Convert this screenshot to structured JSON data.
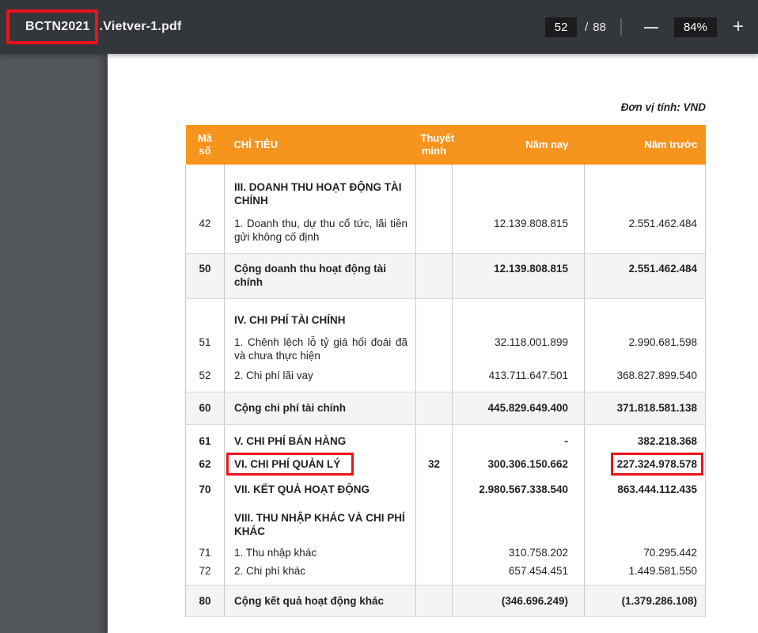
{
  "toolbar": {
    "filename_highlight": "BCTN2021",
    "filename_rest": ".Vietver-1.pdf",
    "page_current": "52",
    "page_separator": "/",
    "page_total": "88",
    "zoom_out_label": "—",
    "zoom_level": "84%",
    "zoom_in_label": "+"
  },
  "page": {
    "unit_note": "Đơn vị tính: VND",
    "table": {
      "headers": {
        "ma_so": "Mã số",
        "chi_tieu": "CHỈ TIÊU",
        "thuyet_minh": "Thuyết minh",
        "nam_nay": "Năm nay",
        "nam_truoc": "Năm trước"
      },
      "rows": [
        {
          "ma_so": "",
          "chi_tieu": "III. DOANH THU HOẠT ĐỘNG TÀI CHÍNH",
          "thuyet_minh": "",
          "nam_nay": "",
          "nam_truoc": ""
        },
        {
          "ma_so": "42",
          "chi_tieu": "1. Doanh thu, dự thu cổ tức, lãi tiền gửi không cố định",
          "thuyet_minh": "",
          "nam_nay": "12.139.808.815",
          "nam_truoc": "2.551.462.484"
        },
        {
          "ma_so": "50",
          "chi_tieu": "Cộng doanh thu hoạt động tài chính",
          "thuyet_minh": "",
          "nam_nay": "12.139.808.815",
          "nam_truoc": "2.551.462.484"
        },
        {
          "ma_so": "",
          "chi_tieu": "IV. CHI PHÍ TÀI CHÍNH",
          "thuyet_minh": "",
          "nam_nay": "",
          "nam_truoc": ""
        },
        {
          "ma_so": "51",
          "chi_tieu": "1. Chênh lệch lỗ tỷ giá hối đoái đã và chưa thực hiện",
          "thuyet_minh": "",
          "nam_nay": "32.118.001.899",
          "nam_truoc": "2.990.681.598"
        },
        {
          "ma_so": "52",
          "chi_tieu": "2. Chi phí lãi vay",
          "thuyet_minh": "",
          "nam_nay": "413.711.647.501",
          "nam_truoc": "368.827.899.540"
        },
        {
          "ma_so": "60",
          "chi_tieu": "Cộng chi phí tài chính",
          "thuyet_minh": "",
          "nam_nay": "445.829.649.400",
          "nam_truoc": "371.818.581.138"
        },
        {
          "ma_so": "61",
          "chi_tieu": "V. CHI PHÍ BÁN HÀNG",
          "thuyet_minh": "",
          "nam_nay": "-",
          "nam_truoc": "382.218.368"
        },
        {
          "ma_so": "62",
          "chi_tieu": "VI. CHI PHÍ QUẢN LÝ",
          "thuyet_minh": "32",
          "nam_nay": "300.306.150.662",
          "nam_truoc": "227.324.978.578"
        },
        {
          "ma_so": "70",
          "chi_tieu": "VII. KẾT QUẢ HOẠT ĐỘNG",
          "thuyet_minh": "",
          "nam_nay": "2.980.567.338.540",
          "nam_truoc": "863.444.112.435"
        },
        {
          "ma_so": "",
          "chi_tieu": "VIII. THU NHẬP KHÁC VÀ CHI PHÍ KHÁC",
          "thuyet_minh": "",
          "nam_nay": "",
          "nam_truoc": ""
        },
        {
          "ma_so": "71",
          "chi_tieu": "1. Thu nhập khác",
          "thuyet_minh": "",
          "nam_nay": "310.758.202",
          "nam_truoc": "70.295.442"
        },
        {
          "ma_so": "72",
          "chi_tieu": "2. Chi phí khác",
          "thuyet_minh": "",
          "nam_nay": "657.454.451",
          "nam_truoc": "1.449.581.550"
        },
        {
          "ma_so": "80",
          "chi_tieu": "Cộng kết quả hoạt động khác",
          "thuyet_minh": "",
          "nam_nay": "(346.696.249)",
          "nam_truoc": "(1.379.286.108)"
        }
      ]
    }
  },
  "colors": {
    "toolbar_bg": "#33363B",
    "viewer_bg": "#53575A",
    "table_header_orange": "#F7941E",
    "annotation_red": "#E9141B",
    "subtotal_row_bg": "#F4F4F4",
    "text_color": "#231F20"
  }
}
